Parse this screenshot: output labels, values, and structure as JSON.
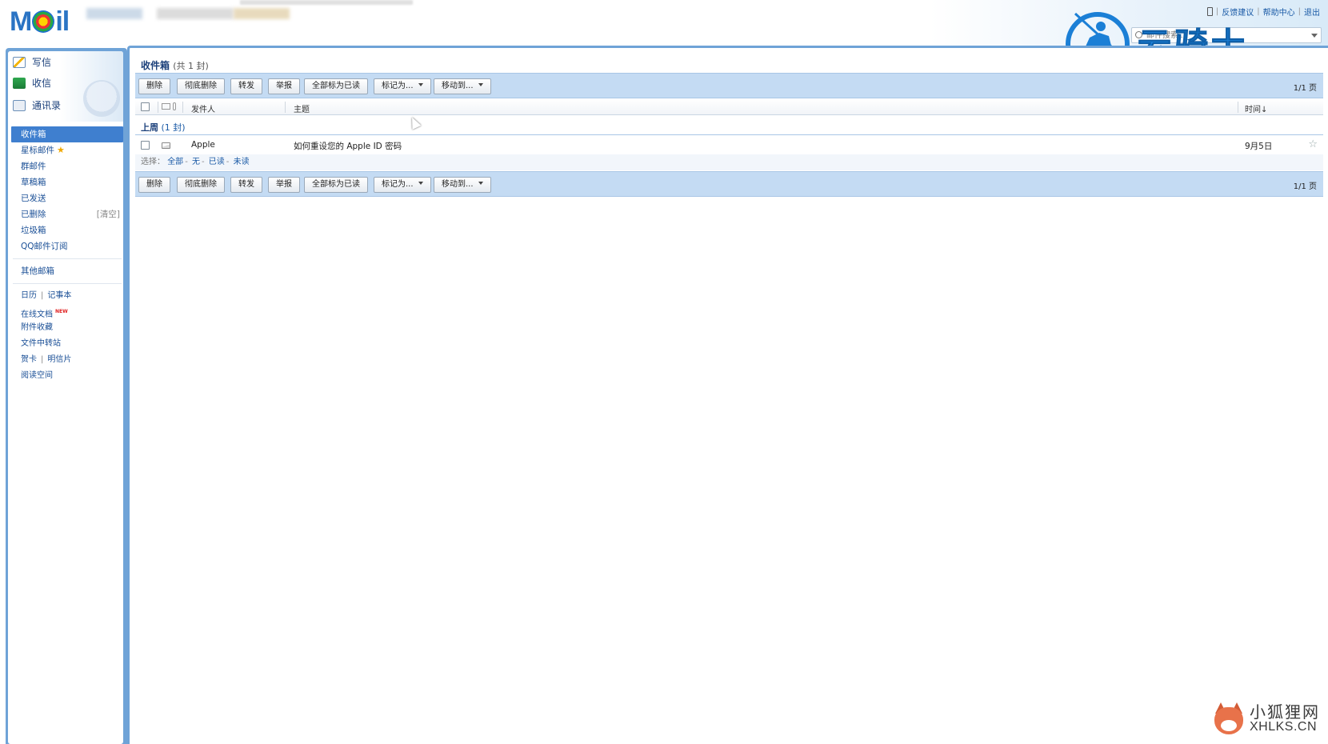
{
  "header": {
    "logo_text_pre": "M",
    "logo_text_post": "il",
    "top_links": [
      "反馈建议",
      "帮助中心",
      "退出"
    ],
    "search": {
      "placeholder": "邮件搜索..."
    },
    "watermark_text": "云骑士"
  },
  "quick_actions": [
    {
      "label": "写信",
      "icon": "compose-icon"
    },
    {
      "label": "收信",
      "icon": "inbox-download-icon"
    },
    {
      "label": "通讯录",
      "icon": "contacts-icon"
    }
  ],
  "folders": [
    {
      "label": "收件箱",
      "active": true
    },
    {
      "label": "星标邮件",
      "star": true
    },
    {
      "label": "群邮件"
    },
    {
      "label": "草稿箱"
    },
    {
      "label": "已发送"
    },
    {
      "label": "已删除",
      "extra": "[清空]"
    },
    {
      "label": "垃圾箱"
    },
    {
      "label": "QQ邮件订阅"
    }
  ],
  "other_mailbox": "其他邮箱",
  "tools": {
    "calendar": "日历",
    "notes": "记事本",
    "online_docs": "在线文档",
    "new_badge": "NEW",
    "attachments": "附件收藏",
    "file_transfer": "文件中转站",
    "greeting_card": "贺卡",
    "postcard": "明信片",
    "reading_space": "阅读空间"
  },
  "main": {
    "title": "收件箱",
    "title_count": "(共 1 封)",
    "toolbar": {
      "delete": "删除",
      "delete_perm": "彻底删除",
      "forward": "转发",
      "report": "举报",
      "mark_all_read": "全部标为已读",
      "mark_as": "标记为...",
      "move_to": "移动到...",
      "pager": "1/1 页"
    },
    "columns": {
      "sender": "发件人",
      "subject": "主题",
      "time": "时间↓"
    },
    "group": {
      "label": "上周",
      "count": "(1 封)"
    },
    "emails": [
      {
        "sender": "Apple",
        "subject": "如何重设您的 Apple ID 密码",
        "time": "9月5日"
      }
    ],
    "select": {
      "label": "选择：",
      "all": "全部",
      "none": "无",
      "read": "已读",
      "unread": "未读"
    }
  },
  "watermark": {
    "cn": "小狐狸网",
    "en": "XHLKS.CN"
  },
  "colors": {
    "accent": "#3f7fcf",
    "toolbar": "#c4dbf3",
    "frame": "#6fa3d7"
  }
}
